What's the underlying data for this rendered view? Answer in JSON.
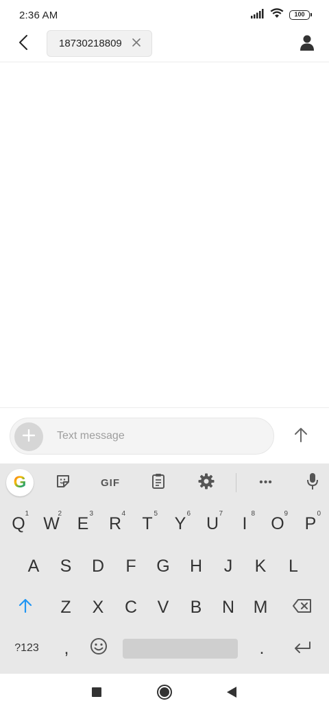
{
  "status_bar": {
    "time": "2:36 AM",
    "battery": "100",
    "icons": [
      "signal-icon",
      "wifi-icon",
      "battery-icon"
    ]
  },
  "header": {
    "recipient": "18730218809",
    "icons": [
      "back-arrow-icon",
      "close-icon",
      "person-icon"
    ]
  },
  "compose": {
    "placeholder": "Text message",
    "icons": [
      "plus-icon",
      "send-arrow-icon"
    ]
  },
  "keyboard": {
    "toolbar": {
      "google_label": "G",
      "gif_label": "GIF",
      "more_label": "•••",
      "icons": [
        "google-icon",
        "sticker-icon",
        "gif-icon",
        "clipboard-icon",
        "settings-icon",
        "more-icon",
        "mic-icon"
      ]
    },
    "row1": [
      {
        "key": "Q",
        "hint": "1"
      },
      {
        "key": "W",
        "hint": "2"
      },
      {
        "key": "E",
        "hint": "3"
      },
      {
        "key": "R",
        "hint": "4"
      },
      {
        "key": "T",
        "hint": "5"
      },
      {
        "key": "Y",
        "hint": "6"
      },
      {
        "key": "U",
        "hint": "7"
      },
      {
        "key": "I",
        "hint": "8"
      },
      {
        "key": "O",
        "hint": "9"
      },
      {
        "key": "P",
        "hint": "0"
      }
    ],
    "row2": [
      "A",
      "S",
      "D",
      "F",
      "G",
      "H",
      "J",
      "K",
      "L"
    ],
    "row3": [
      "Z",
      "X",
      "C",
      "V",
      "B",
      "N",
      "M"
    ],
    "row4": {
      "symbols": "?123",
      "comma": ",",
      "period": "."
    },
    "colors": {
      "shift_accent": "#2196f3",
      "background": "#e8e8e8"
    }
  },
  "nav_bar": {
    "icons": [
      "recents-square-icon",
      "home-circle-icon",
      "back-triangle-icon"
    ]
  }
}
